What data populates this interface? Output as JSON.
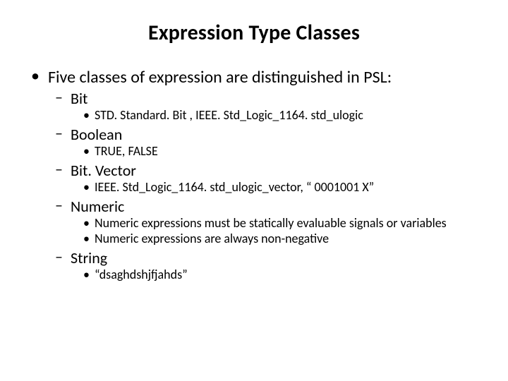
{
  "title": "Expression Type Classes",
  "main_bullet": "Five classes of expression are distinguished in PSL:",
  "items": [
    {
      "label": "Bit",
      "sub": [
        "STD. Standard. Bit , IEEE. Std_Logic_1164. std_ulogic"
      ]
    },
    {
      "label": "Boolean",
      "sub": [
        "TRUE, FALSE"
      ]
    },
    {
      "label": "Bit. Vector",
      "sub": [
        "IEEE. Std_Logic_1164. std_ulogic_vector, “ 0001001 X”"
      ]
    },
    {
      "label": "Numeric",
      "sub": [
        "Numeric expressions must be statically evaluable signals or variables",
        "Numeric expressions are always non-negative"
      ]
    },
    {
      "label": "String",
      "sub": [
        "“dsaghdshjfjahds”"
      ]
    }
  ]
}
